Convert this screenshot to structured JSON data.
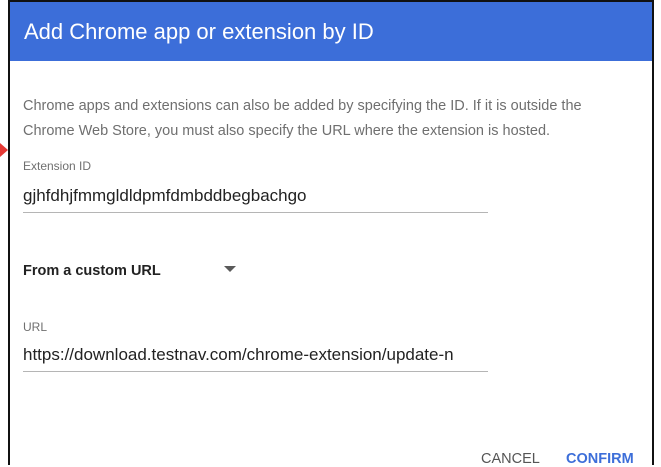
{
  "dialog": {
    "title": "Add Chrome app or extension by ID",
    "description": "Chrome apps and extensions can also be added by specifying the ID. If it is outside the Chrome Web Store, you must also specify the URL where the extension is hosted."
  },
  "extension_id": {
    "label": "Extension ID",
    "value": "gjhfdhjfmmgldldpmfdmbddbegbachgo"
  },
  "source_select": {
    "selected": "From a custom URL"
  },
  "url_field": {
    "label": "URL",
    "value": "https://download.testnav.com/chrome-extension/update-n"
  },
  "actions": {
    "cancel": "CANCEL",
    "confirm": "CONFIRM"
  },
  "colors": {
    "header": "#3c6ed9",
    "accent": "#3c6ed9",
    "annotation_arrow": "#e53935"
  }
}
